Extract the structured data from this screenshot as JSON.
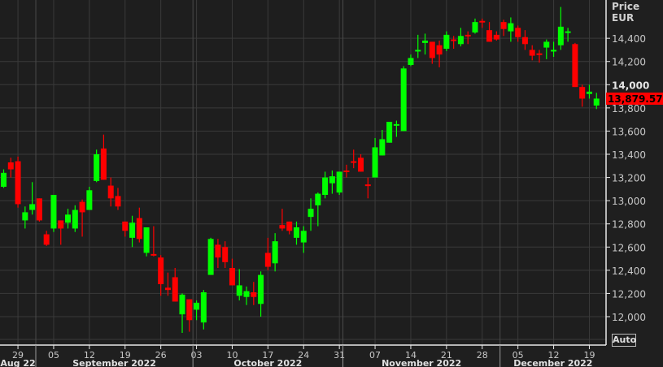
{
  "chart_data": {
    "type": "candlestick",
    "axis_title": "Price",
    "currency": "EUR",
    "last_price_label": "13,879.570",
    "ylim": [
      11800,
      14750
    ],
    "y_ticks": [
      12000,
      12200,
      12400,
      12600,
      12800,
      13000,
      13200,
      13400,
      13600,
      13800,
      14000,
      14200,
      14400
    ],
    "y_tick_labels": [
      "12,000",
      "12,200",
      "12,400",
      "12,600",
      "12,800",
      "13,000",
      "13,200",
      "13,400",
      "13,600",
      "13,800",
      "14,000",
      "14,200",
      "14,400"
    ],
    "x_ticks": [
      {
        "label": "29",
        "day": 2
      },
      {
        "label": "05",
        "day": 7
      },
      {
        "label": "12",
        "day": 12
      },
      {
        "label": "19",
        "day": 17
      },
      {
        "label": "26",
        "day": 22
      },
      {
        "label": "03",
        "day": 27
      },
      {
        "label": "10",
        "day": 32
      },
      {
        "label": "17",
        "day": 37
      },
      {
        "label": "24",
        "day": 42
      },
      {
        "label": "31",
        "day": 47
      },
      {
        "label": "07",
        "day": 52
      },
      {
        "label": "14",
        "day": 57
      },
      {
        "label": "21",
        "day": 62
      },
      {
        "label": "28",
        "day": 67
      },
      {
        "label": "05",
        "day": 72
      },
      {
        "label": "12",
        "day": 77
      },
      {
        "label": "19",
        "day": 82
      }
    ],
    "months": [
      {
        "label": "Aug 22",
        "start": 0,
        "end": 4.5
      },
      {
        "label": "September 2022",
        "start": 4.5,
        "end": 26.5
      },
      {
        "label": "October 2022",
        "start": 26.5,
        "end": 47.5
      },
      {
        "label": "November 2022",
        "start": 47.5,
        "end": 69.5
      },
      {
        "label": "December 2022",
        "start": 69.5,
        "end": 86
      }
    ],
    "up_color": "#00ff00",
    "down_color": "#ff0000",
    "ohlc": [
      [
        13120,
        13270,
        13110,
        13240
      ],
      [
        13330,
        13370,
        13200,
        13270
      ],
      [
        13340,
        13380,
        12940,
        12970
      ],
      [
        12830,
        12950,
        12760,
        12900
      ],
      [
        12920,
        13160,
        12880,
        12970
      ],
      [
        13020,
        13020,
        12820,
        12830
      ],
      [
        12710,
        12740,
        12610,
        12620
      ],
      [
        12760,
        13050,
        12730,
        13050
      ],
      [
        12830,
        12830,
        12620,
        12760
      ],
      [
        12810,
        12930,
        12760,
        12880
      ],
      [
        12760,
        12960,
        12730,
        12920
      ],
      [
        12990,
        13010,
        12690,
        12900
      ],
      [
        12920,
        13120,
        12920,
        13090
      ],
      [
        13170,
        13440,
        13160,
        13400
      ],
      [
        13450,
        13570,
        13180,
        13180
      ],
      [
        13130,
        13200,
        12950,
        13020
      ],
      [
        13040,
        13110,
        12920,
        12950
      ],
      [
        12820,
        12820,
        12690,
        12740
      ],
      [
        12680,
        12870,
        12600,
        12810
      ],
      [
        12850,
        12940,
        12640,
        12670
      ],
      [
        12550,
        12770,
        12520,
        12770
      ],
      [
        12540,
        12780,
        12520,
        12530
      ],
      [
        12510,
        12530,
        12180,
        12280
      ],
      [
        12250,
        12380,
        12180,
        12230
      ],
      [
        12340,
        12420,
        12130,
        12130
      ],
      [
        12020,
        12200,
        11860,
        12190
      ],
      [
        12150,
        12150,
        11870,
        11970
      ],
      [
        12060,
        12140,
        11970,
        12120
      ],
      [
        11950,
        12230,
        11890,
        12210
      ],
      [
        12360,
        12680,
        12360,
        12670
      ],
      [
        12620,
        12670,
        12420,
        12510
      ],
      [
        12600,
        12650,
        12420,
        12470
      ],
      [
        12420,
        12500,
        12270,
        12270
      ],
      [
        12180,
        12410,
        12140,
        12270
      ],
      [
        12170,
        12260,
        12100,
        12220
      ],
      [
        12210,
        12300,
        12100,
        12170
      ],
      [
        12110,
        12390,
        12000,
        12360
      ],
      [
        12550,
        12680,
        12400,
        12430
      ],
      [
        12460,
        12720,
        12390,
        12650
      ],
      [
        12790,
        12930,
        12740,
        12760
      ],
      [
        12820,
        12820,
        12710,
        12740
      ],
      [
        12680,
        12820,
        12620,
        12770
      ],
      [
        12640,
        12780,
        12550,
        12740
      ],
      [
        12860,
        13020,
        12740,
        12930
      ],
      [
        12960,
        13070,
        12780,
        13060
      ],
      [
        13050,
        13250,
        13020,
        13200
      ],
      [
        13150,
        13260,
        13060,
        13210
      ],
      [
        13070,
        13250,
        13050,
        13250
      ],
      [
        13260,
        13310,
        13200,
        13250
      ],
      [
        13340,
        13440,
        13280,
        13330
      ],
      [
        13370,
        13400,
        13250,
        13250
      ],
      [
        13140,
        13200,
        13020,
        13130
      ],
      [
        13200,
        13540,
        13200,
        13460
      ],
      [
        13390,
        13610,
        13390,
        13530
      ],
      [
        13500,
        13680,
        13500,
        13680
      ],
      [
        13650,
        13690,
        13550,
        13660
      ],
      [
        13600,
        14160,
        13600,
        14140
      ],
      [
        14170,
        14260,
        14160,
        14230
      ],
      [
        14290,
        14430,
        14230,
        14300
      ],
      [
        14360,
        14440,
        14260,
        14380
      ],
      [
        14370,
        14370,
        14180,
        14230
      ],
      [
        14340,
        14380,
        14150,
        14260
      ],
      [
        14310,
        14460,
        14290,
        14430
      ],
      [
        14390,
        14420,
        14310,
        14380
      ],
      [
        14350,
        14490,
        14330,
        14420
      ],
      [
        14430,
        14460,
        14350,
        14420
      ],
      [
        14450,
        14570,
        14440,
        14540
      ],
      [
        14550,
        14570,
        14490,
        14540
      ],
      [
        14470,
        14540,
        14370,
        14370
      ],
      [
        14430,
        14460,
        14380,
        14390
      ],
      [
        14540,
        14560,
        14420,
        14480
      ],
      [
        14460,
        14580,
        14370,
        14530
      ],
      [
        14490,
        14510,
        14370,
        14410
      ],
      [
        14410,
        14470,
        14300,
        14350
      ],
      [
        14300,
        14340,
        14210,
        14250
      ],
      [
        14270,
        14300,
        14190,
        14260
      ],
      [
        14320,
        14390,
        14220,
        14370
      ],
      [
        14290,
        14370,
        14240,
        14300
      ],
      [
        14340,
        14670,
        14300,
        14500
      ],
      [
        14450,
        14490,
        14370,
        14460
      ],
      [
        14350,
        14360,
        13980,
        13980
      ],
      [
        13980,
        14000,
        13810,
        13880
      ],
      [
        13920,
        14000,
        13880,
        13940
      ],
      [
        13820,
        13930,
        13790,
        13880
      ]
    ]
  },
  "controls": {
    "auto_label": "Auto"
  }
}
